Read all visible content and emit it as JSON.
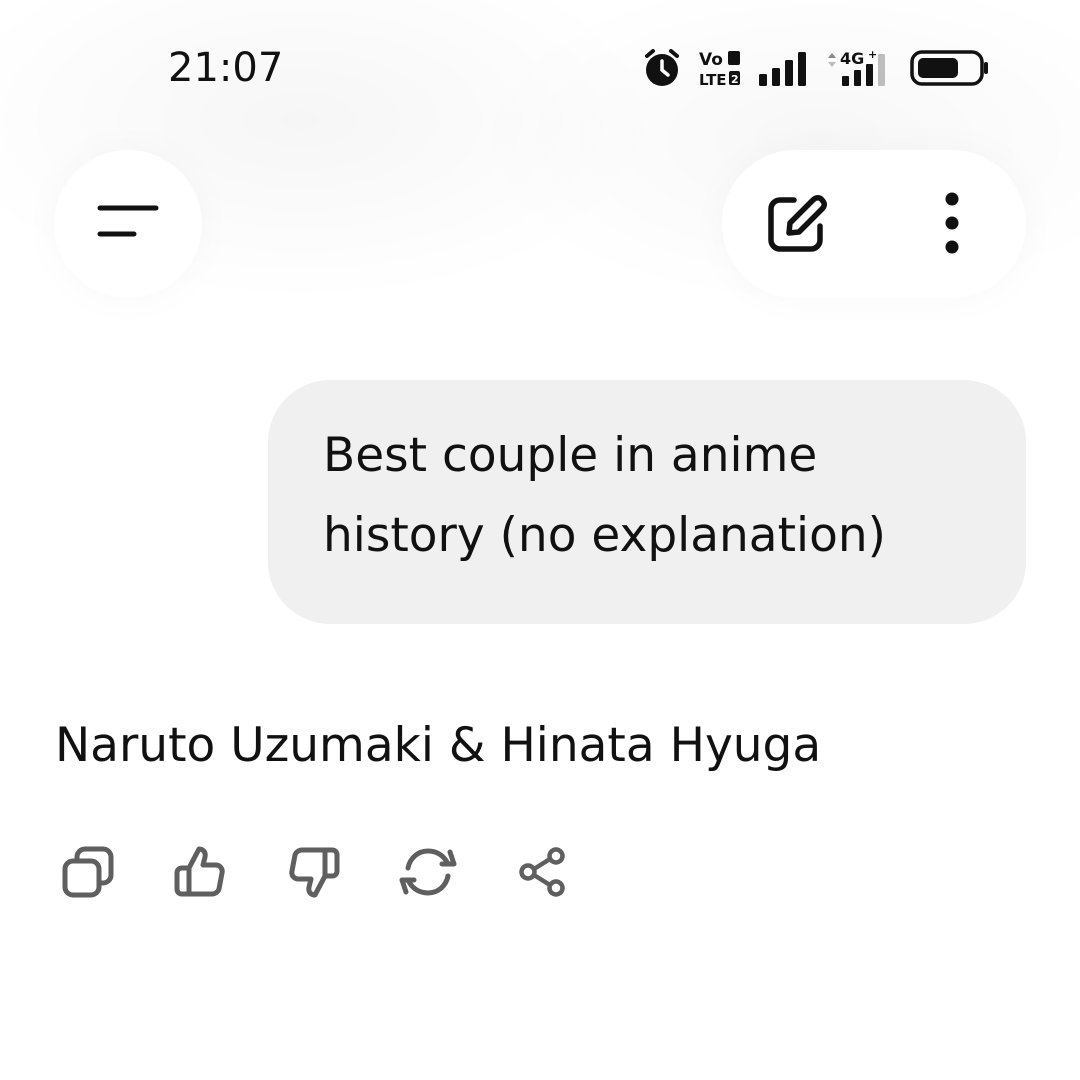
{
  "status_bar": {
    "time": "21:07",
    "icons": [
      "alarm-icon",
      "volte-icon",
      "signal-icon",
      "signal-4g-icon",
      "battery-icon"
    ],
    "volte_label": "Vo LTE",
    "network_label": "4G+"
  },
  "header": {
    "menu_icon": "menu-icon",
    "new_chat_icon": "edit-icon",
    "more_icon": "more-vertical-icon"
  },
  "conversation": {
    "user_message": "Best couple in anime\nhistory (no explanation)",
    "assistant_message": "Naruto Uzumaki & Hinata Hyuga"
  },
  "response_actions": [
    "copy-icon",
    "thumbs-up-icon",
    "thumbs-down-icon",
    "regenerate-icon",
    "share-icon"
  ],
  "colors": {
    "text": "#111111",
    "bubble": "#f0f0f0",
    "icon_gray": "#5f5f5f"
  }
}
